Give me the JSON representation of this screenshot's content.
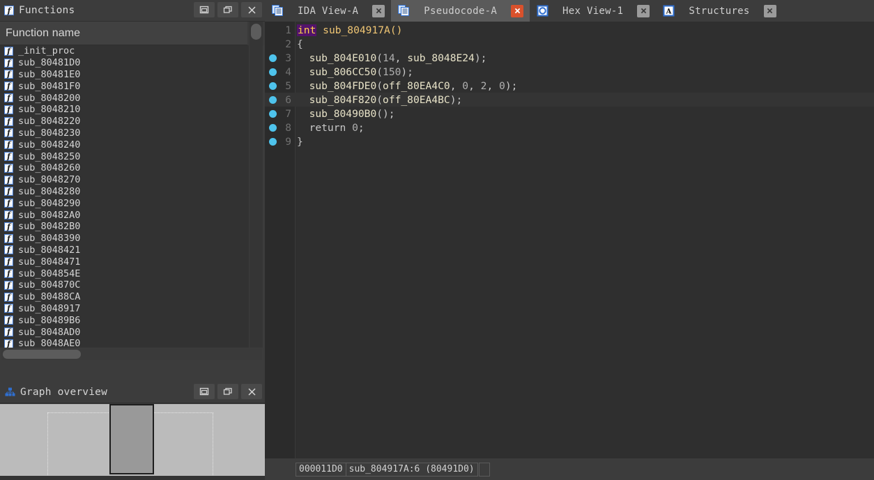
{
  "functions_panel": {
    "title": "Functions",
    "title_icon": "function-icon",
    "window_buttons": [
      {
        "name": "restore-button",
        "icon": "restore-icon"
      },
      {
        "name": "maximize-button",
        "icon": "maximize-icon"
      },
      {
        "name": "close-button",
        "icon": "close-icon"
      }
    ],
    "column_header": "Function name",
    "items": [
      "_init_proc",
      "sub_80481D0",
      "sub_80481E0",
      "sub_80481F0",
      "sub_8048200",
      "sub_8048210",
      "sub_8048220",
      "sub_8048230",
      "sub_8048240",
      "sub_8048250",
      "sub_8048260",
      "sub_8048270",
      "sub_8048280",
      "sub_8048290",
      "sub_80482A0",
      "sub_80482B0",
      "sub_8048390",
      "sub_8048421",
      "sub_8048471",
      "sub_804854E",
      "sub_804870C",
      "sub_80488CA",
      "sub_8048917",
      "sub_80489B6",
      "sub_8048AD0",
      "sub_8048AE0"
    ]
  },
  "graph_panel": {
    "title": "Graph overview",
    "title_icon": "graph-icon",
    "window_buttons": [
      {
        "name": "restore-button",
        "icon": "restore-icon"
      },
      {
        "name": "maximize-button",
        "icon": "maximize-icon"
      },
      {
        "name": "close-button",
        "icon": "close-icon"
      }
    ]
  },
  "tabs": [
    {
      "label": "IDA View-A",
      "icon": "document-view-icon",
      "active": false,
      "close_icon": "close-icon"
    },
    {
      "label": "Pseudocode-A",
      "icon": "document-view-icon",
      "active": true,
      "close_icon": "close-icon"
    },
    {
      "label": "Hex View-1",
      "icon": "hex-view-icon",
      "active": false,
      "close_icon": "close-icon"
    },
    {
      "label": "Structures",
      "icon": "structures-icon",
      "active": false,
      "close_icon": "close-icon"
    }
  ],
  "code": {
    "lines": [
      {
        "num": "1",
        "breakpoint": false,
        "current": false,
        "tokens": [
          {
            "t": "int",
            "c": "t-kw"
          },
          {
            "t": " ",
            "c": "t-punct"
          },
          {
            "t": "sub_804917A",
            "c": "t-fn"
          },
          {
            "t": "()",
            "c": "t-fn"
          }
        ]
      },
      {
        "num": "2",
        "breakpoint": false,
        "current": false,
        "tokens": [
          {
            "t": "{",
            "c": "t-brace"
          }
        ]
      },
      {
        "num": "3",
        "breakpoint": true,
        "current": false,
        "tokens": [
          {
            "t": "  ",
            "c": "t-punct"
          },
          {
            "t": "sub_804E010",
            "c": "t-func"
          },
          {
            "t": "(",
            "c": "t-punct"
          },
          {
            "t": "14",
            "c": "t-num"
          },
          {
            "t": ", ",
            "c": "t-punct"
          },
          {
            "t": "sub_8048E24",
            "c": "t-func"
          },
          {
            "t": ");",
            "c": "t-punct"
          }
        ]
      },
      {
        "num": "4",
        "breakpoint": true,
        "current": false,
        "tokens": [
          {
            "t": "  ",
            "c": "t-punct"
          },
          {
            "t": "sub_806CC50",
            "c": "t-func"
          },
          {
            "t": "(",
            "c": "t-punct"
          },
          {
            "t": "150",
            "c": "t-num"
          },
          {
            "t": ");",
            "c": "t-punct"
          }
        ]
      },
      {
        "num": "5",
        "breakpoint": true,
        "current": false,
        "tokens": [
          {
            "t": "  ",
            "c": "t-punct"
          },
          {
            "t": "sub_804FDE0",
            "c": "t-func"
          },
          {
            "t": "(",
            "c": "t-punct"
          },
          {
            "t": "off_80EA4C0",
            "c": "t-global"
          },
          {
            "t": ", ",
            "c": "t-punct"
          },
          {
            "t": "0",
            "c": "t-num"
          },
          {
            "t": ", ",
            "c": "t-punct"
          },
          {
            "t": "2",
            "c": "t-num"
          },
          {
            "t": ", ",
            "c": "t-punct"
          },
          {
            "t": "0",
            "c": "t-num"
          },
          {
            "t": ");",
            "c": "t-punct"
          }
        ]
      },
      {
        "num": "6",
        "breakpoint": true,
        "current": true,
        "tokens": [
          {
            "t": "  ",
            "c": "t-punct"
          },
          {
            "t": "sub_804F820",
            "c": "t-func"
          },
          {
            "t": "(",
            "c": "t-punct"
          },
          {
            "t": "off_80EA4BC",
            "c": "t-global"
          },
          {
            "t": ");",
            "c": "t-punct"
          }
        ]
      },
      {
        "num": "7",
        "breakpoint": true,
        "current": false,
        "tokens": [
          {
            "t": "  ",
            "c": "t-punct"
          },
          {
            "t": "sub_80490B0",
            "c": "t-func"
          },
          {
            "t": "();",
            "c": "t-punct"
          }
        ]
      },
      {
        "num": "8",
        "breakpoint": true,
        "current": false,
        "tokens": [
          {
            "t": "  ",
            "c": "t-punct"
          },
          {
            "t": "return",
            "c": "t-ret"
          },
          {
            "t": " ",
            "c": "t-punct"
          },
          {
            "t": "0",
            "c": "t-num"
          },
          {
            "t": ";",
            "c": "t-punct"
          }
        ]
      },
      {
        "num": "9",
        "breakpoint": true,
        "current": false,
        "tokens": [
          {
            "t": "}",
            "c": "t-brace"
          }
        ]
      }
    ]
  },
  "statusbar": {
    "offset": "000011D0",
    "location": "sub_804917A:6  (80491D0)",
    "extra": ""
  },
  "colors": {
    "accent_breakpoint": "#4ec3ec",
    "keyword_highlight_bg": "#53136b",
    "keyword_fg": "#ffd24a",
    "tab_active_bg": "#5a5a5a",
    "tab_active_close": "#d9512c",
    "panel_bg": "#3c3c3c",
    "code_bg": "#2f2f2f",
    "graph_bg": "#bbbbbb"
  }
}
